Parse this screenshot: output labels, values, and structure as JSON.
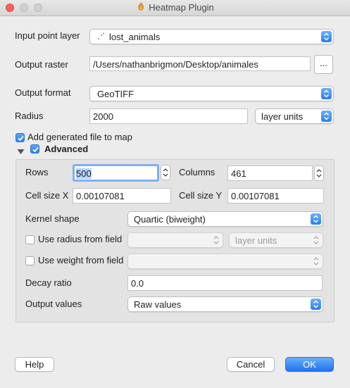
{
  "window": {
    "title": "Heatmap Plugin"
  },
  "form": {
    "input_layer_label": "Input point layer",
    "input_layer_value": "lost_animals",
    "output_raster_label": "Output raster",
    "output_raster_value": "/Users/nathanbrigmon/Desktop/animales",
    "browse_label": "...",
    "output_format_label": "Output format",
    "output_format_value": "GeoTIFF",
    "radius_label": "Radius",
    "radius_value": "2000",
    "radius_units": "layer units",
    "add_to_map_label": "Add generated file to map",
    "add_to_map_checked": true
  },
  "advanced": {
    "label": "Advanced",
    "checked": true,
    "rows_label": "Rows",
    "rows_value": "500",
    "columns_label": "Columns",
    "columns_value": "461",
    "cellsize_x_label": "Cell size X",
    "cellsize_x_value": "0.00107081",
    "cellsize_y_label": "Cell size Y",
    "cellsize_y_value": "0.00107081",
    "kernel_label": "Kernel shape",
    "kernel_value": "Quartic (biweight)",
    "radius_field_label": "Use radius from field",
    "radius_field_checked": false,
    "radius_field_units": "layer units",
    "weight_field_label": "Use weight from field",
    "weight_field_checked": false,
    "decay_label": "Decay ratio",
    "decay_value": "0.0",
    "output_values_label": "Output values",
    "output_values_value": "Raw values"
  },
  "buttons": {
    "help": "Help",
    "cancel": "Cancel",
    "ok": "OK"
  },
  "colors": {
    "accent": "#2a7df3",
    "close": "#fc605c",
    "background": "#ececec"
  }
}
